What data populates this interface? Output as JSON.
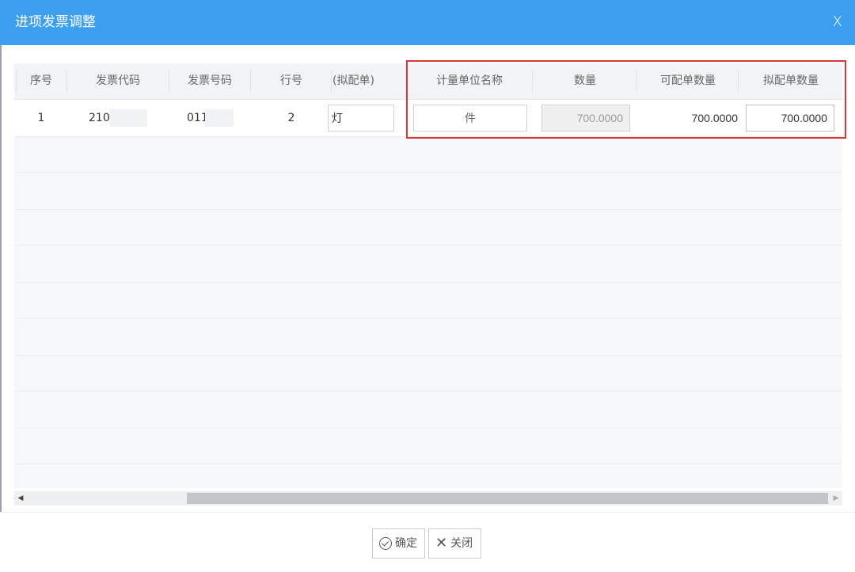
{
  "dialog": {
    "title": "进项发票调整",
    "close_glyph": "X"
  },
  "table": {
    "headers": {
      "seq": "序号",
      "invoice_code": "发票代码",
      "invoice_number": "发票号码",
      "line_no": "行号",
      "planned_partial": "(拟配单)",
      "unit_name": "计量单位名称",
      "quantity": "数量",
      "available_qty": "可配单数量",
      "planned_qty": "拟配单数量"
    },
    "rows": [
      {
        "seq": "1",
        "invoice_code": "210",
        "invoice_number": "011",
        "line_no": "2",
        "planned_partial": "灯",
        "unit_name": "件",
        "quantity": "700.0000",
        "available_qty": "700.0000",
        "planned_qty": "700.0000"
      }
    ]
  },
  "footer": {
    "confirm_label": "确定",
    "close_label": "关闭"
  }
}
